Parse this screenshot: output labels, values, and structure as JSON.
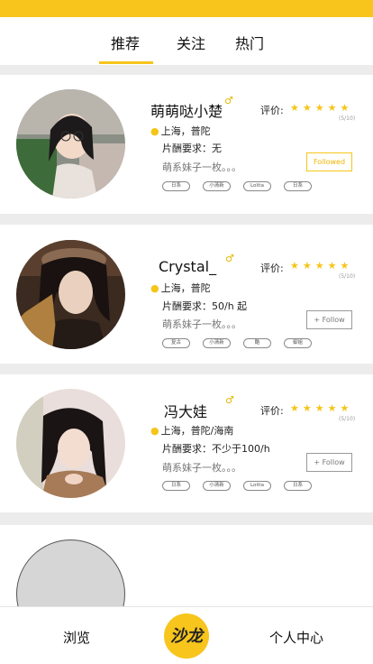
{
  "tabs": [
    {
      "label": "推荐",
      "active": true
    },
    {
      "label": "关注",
      "active": false
    },
    {
      "label": "热门",
      "active": false
    }
  ],
  "colors": {
    "accent": "#f7c51c",
    "star": "#f5c518"
  },
  "profiles": [
    {
      "name": "萌萌哒小楚",
      "gender_icon": "male-icon",
      "gender_symbol": "♂",
      "rating_label": "评价:",
      "stars": "★★★★★",
      "rating_score": "(5/10)",
      "location": "上海，普陀",
      "requirement": "片酬要求：无",
      "bio": "萌系妹子一枚。。。",
      "tags": [
        "日系",
        "小清新",
        "Lolita",
        "日系"
      ],
      "follow_label": "Followed",
      "followed": true
    },
    {
      "name": "Crystal_",
      "gender_icon": "male-icon",
      "gender_symbol": "♂",
      "rating_label": "评价:",
      "stars": "★★★★★",
      "rating_score": "(5/10)",
      "location": "上海，普陀",
      "requirement": "片酬要求：50/h 起",
      "bio": "萌系妹子一枚。。。",
      "tags": [
        "复古",
        "小清新",
        "酷",
        "御姐"
      ],
      "follow_label": "+ Follow",
      "followed": false
    },
    {
      "name": "冯大娃",
      "gender_icon": "male-icon",
      "gender_symbol": "♂",
      "rating_label": "评价:",
      "stars": "★★★★★",
      "rating_score": "(5/10)",
      "location": "上海，普陀/海南",
      "requirement": "片酬要求：不少于100/h",
      "bio": "萌系妹子一枚。。。",
      "tags": [
        "日系",
        "小清新",
        "Lolita",
        "日系"
      ],
      "follow_label": "+ Follow",
      "followed": false
    }
  ],
  "bottom_nav": {
    "left_label": "浏览",
    "logo_text": "沙龙",
    "right_label": "个人中心"
  }
}
